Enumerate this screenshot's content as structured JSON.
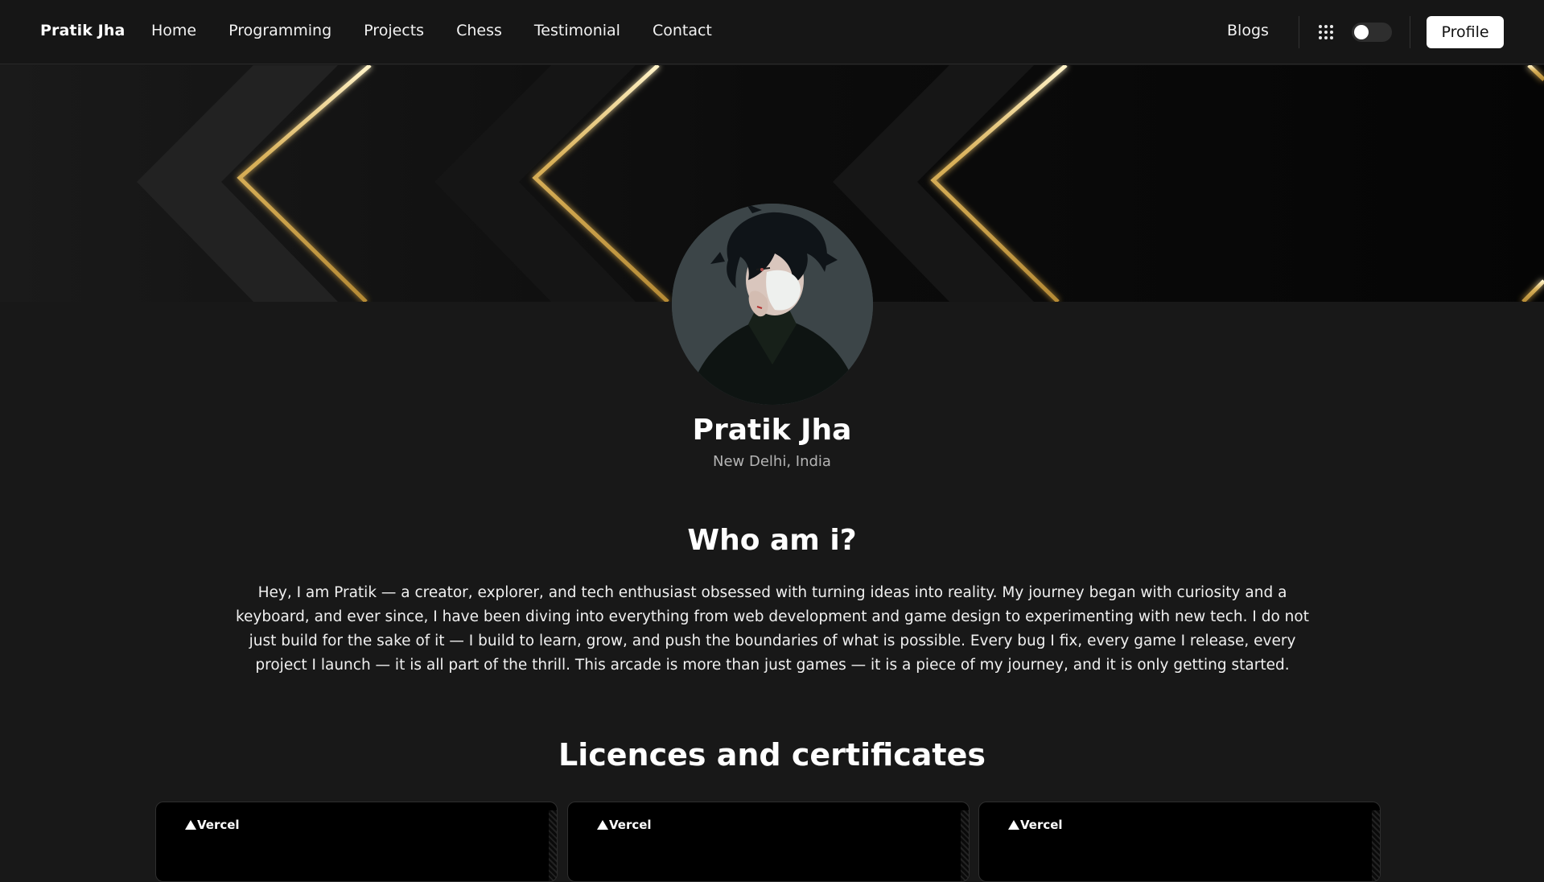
{
  "nav": {
    "brand": "Pratik Jha",
    "links": [
      "Home",
      "Programming",
      "Projects",
      "Chess",
      "Testimonial",
      "Contact"
    ],
    "blogs": "Blogs",
    "apps_icon": "grid-dots-icon",
    "theme_toggle": "off",
    "profile": "Profile"
  },
  "profile": {
    "name": "Pratik Jha",
    "location": "New Delhi, India"
  },
  "about": {
    "title": "Who am i?",
    "text": "Hey, I am Pratik — a creator, explorer, and tech enthusiast obsessed with turning ideas into reality. My journey began with curiosity and a keyboard, and ever since, I have been diving into everything from web development and game design to experimenting with new tech. I do not just build for the sake of it — I build to learn, grow, and push the boundaries of what is possible. Every bug I fix, every game I release, every project I launch — it is all part of the thrill. This arcade is more than just games — it is a piece of my journey, and it is only getting started."
  },
  "certificates": {
    "title": "Licences and certificates",
    "cards": [
      {
        "issuer": "Vercel"
      },
      {
        "issuer": "Vercel"
      },
      {
        "issuer": "Vercel"
      }
    ]
  },
  "colors": {
    "background": "#181818",
    "navbar": "#161616",
    "gold": "#d9b15a",
    "muted": "#b4b4b4"
  }
}
